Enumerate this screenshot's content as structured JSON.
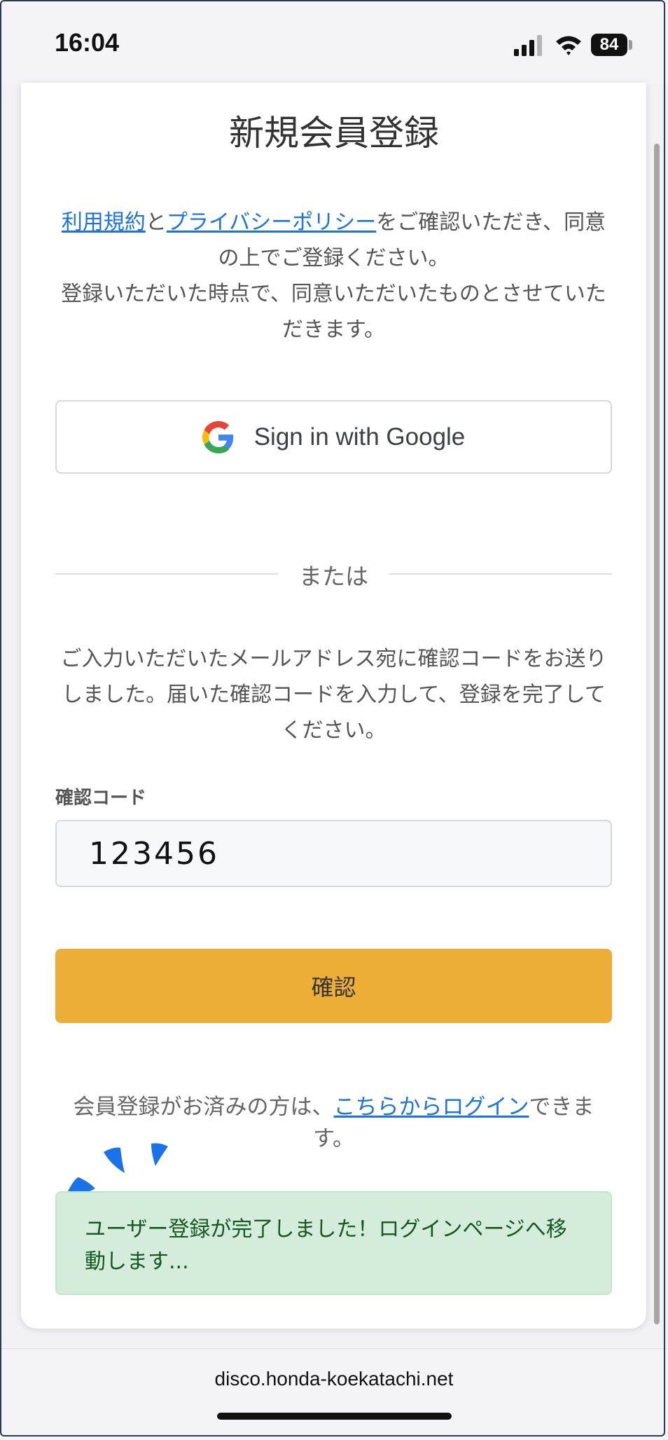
{
  "status_bar": {
    "time": "16:04",
    "battery": "84",
    "icons": [
      "signal-icon",
      "wifi-icon",
      "battery-icon"
    ]
  },
  "page": {
    "title": "新規会員登録",
    "terms": {
      "link_terms": "利用規約",
      "conj": "と",
      "link_privacy": "プライバシーポリシー",
      "text_1": "をご確認いただき、同意の上でご登録ください。",
      "text_2": "登録いただいた時点で、同意いただいたものとさせていただきます。"
    },
    "google_button": "Sign in with Google",
    "divider_text": "または",
    "description": "ご入力いただいたメールアドレス宛に確認コードをお送りしました。届いた確認コードを入力して、登録を完了してください。",
    "code": {
      "label": "確認コード",
      "value": "123456"
    },
    "confirm_button": "確認",
    "login": {
      "prefix": "会員登録がお済みの方は、",
      "link": "こちらからログイン",
      "suffix": "できます。"
    },
    "success_message": "ユーザー登録が完了しました！ログインページへ移動します..."
  },
  "browser": {
    "url": "disco.honda-koekatachi.net"
  },
  "colors": {
    "accent": "#edae38",
    "link": "#1a73e8",
    "success_bg": "#d4edda",
    "success_text": "#155724",
    "sparkle": "#1a73e8"
  }
}
